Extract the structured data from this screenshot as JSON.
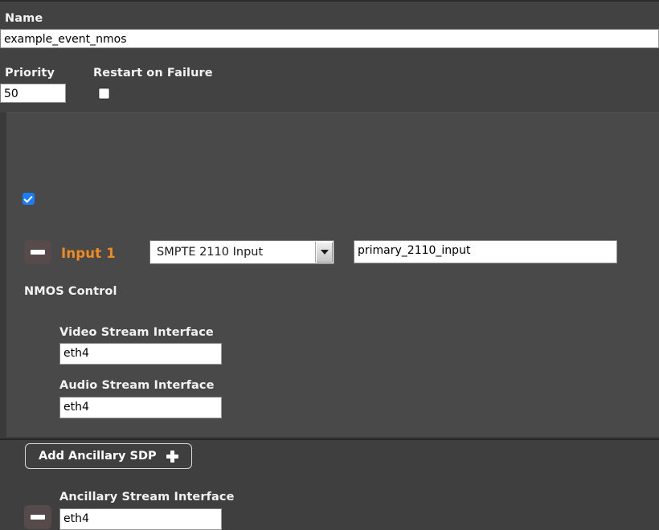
{
  "form": {
    "name": {
      "label": "Name",
      "value": "example_event_nmos"
    },
    "priority": {
      "label": "Priority",
      "value": "50"
    },
    "restart_on_failure": {
      "label": "Restart on Failure",
      "checked": false
    }
  },
  "input_panel": {
    "collapse_icon": "minus-icon",
    "title": "Input 1",
    "title_color": "#f08a22",
    "type_select": {
      "selected": "SMPTE 2110 Input",
      "arrow_icon": "chevron-down-icon"
    },
    "input_name": {
      "value": "primary_2110_input"
    },
    "nmos_control": {
      "label": "NMOS Control",
      "checked": true,
      "accent_color": "#1b7ef7"
    },
    "video_stream_interface": {
      "label": "Video Stream Interface",
      "value": "eth4"
    },
    "audio_stream_interface": {
      "label": "Audio Stream Interface",
      "value": "eth4"
    },
    "add_ancillary_sdp": {
      "label": "Add Ancillary SDP",
      "icon": "plus-icon"
    },
    "ancillary_stream_interface": {
      "label": "Ancillary Stream Interface",
      "value": "eth4",
      "remove_icon": "minus-icon"
    }
  }
}
